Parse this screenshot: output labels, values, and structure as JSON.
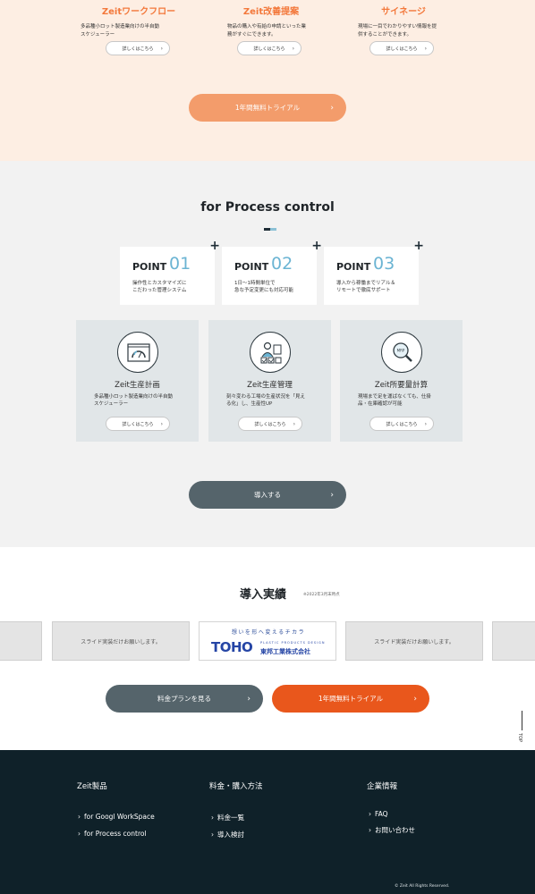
{
  "products_top": [
    {
      "title": "Zeitワークフロー",
      "desc": "多品種小ロット製造業向けの半自動\nスケジューラー",
      "button": "詳しくはこちら"
    },
    {
      "title": "Zeit改善提案",
      "desc": "物品の購入や有給の申請といった業\n務がすぐにできます。",
      "button": "詳しくはこちら"
    },
    {
      "title": "サイネージ",
      "desc": "現場に一目でわかりやすい情報を提\n供することができます。",
      "button": "詳しくはこちら"
    }
  ],
  "trial_button_top": "1年間無料トライアル",
  "process": {
    "title": "for Process control",
    "points": [
      {
        "label": "POINT",
        "number": "01",
        "desc": "操作性とカスタマイズに\nこだわった管理システム"
      },
      {
        "label": "POINT",
        "number": "02",
        "desc": "1日〜1時間単位で\n急な予定変更にも対応可能"
      },
      {
        "label": "POINT",
        "number": "03",
        "desc": "導入から稼働までリアル＆\nリモートで徹底サポート"
      }
    ],
    "cards": [
      {
        "title": "Zeit生産計画",
        "desc": "多品種小ロット製造業向けの半自動\nスケジューラー",
        "button": "詳しくはこちら",
        "icon": "gauge-icon"
      },
      {
        "title": "Zeit生産管理",
        "desc": "刻々変わる工場の生産状況を「見え\nる化」し、生産性UP",
        "button": "詳しくはこちら",
        "icon": "worker-checklist-icon"
      },
      {
        "title": "Zeit所要量計算",
        "desc": "現場まで足を運ばなくても、仕掛\n品・在庫確認が可能",
        "button": "詳しくはこちら",
        "icon": "mrp-search-icon"
      }
    ],
    "introduce_button": "導入する"
  },
  "results": {
    "title": "導入実績",
    "note": "※2022年3月末時点",
    "slide_placeholder": "スライド実装だけお願いします。",
    "logo": {
      "tagline": "想いを形へ変えるチカラ",
      "brand": "TOHO",
      "sub_en": "PLASTIC PRODUCTS DESIGN",
      "sub_jp": "東邦工業株式会社"
    },
    "price_button": "料金プランを見る",
    "trial_button": "1年間無料トライアル",
    "top_link": "TOP"
  },
  "footer": {
    "columns": [
      {
        "title": "Zeit製品",
        "links": [
          "for Googl WorkSpace",
          "for Process control"
        ]
      },
      {
        "title": "料金・購入方法",
        "links": [
          "料金一覧",
          "導入検討"
        ]
      },
      {
        "title": "企業情報",
        "links": [
          "FAQ",
          "お問い合わせ"
        ]
      }
    ],
    "copyright": "© Zeit All Rights Reserved."
  },
  "colors": {
    "accent_orange": "#f3783b",
    "trial_orange_light": "#f39c6b",
    "trial_orange_dark": "#e9571c",
    "slate_button": "#55646b",
    "point_number_blue": "#6bb4d3",
    "footer_bg": "#0f2129"
  }
}
